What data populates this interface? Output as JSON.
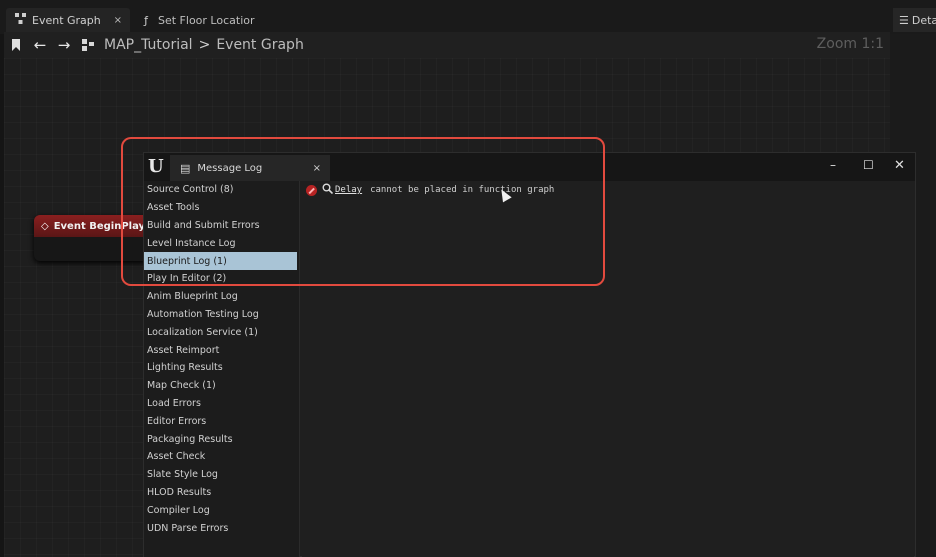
{
  "tabs": [
    {
      "label": "Event Graph",
      "icon": "graph-icon",
      "close": "×"
    },
    {
      "label": "Set Floor Locatior",
      "icon": "function-icon",
      "icon_glyph": "ƒ"
    }
  ],
  "details_tab": {
    "label": "Deta",
    "icon": "details-icon"
  },
  "toolbar": {
    "breadcrumb": [
      "MAP_Tutorial",
      "Event Graph"
    ],
    "separator": ">",
    "zoom": "Zoom 1:1"
  },
  "graph": {
    "event_node": {
      "label": "Event BeginPlay",
      "color": "#8a1f1f"
    }
  },
  "message_log": {
    "title": "Message Log",
    "close": "×",
    "categories": [
      "Source Control (8)",
      "Asset Tools",
      "Build and Submit Errors",
      "Level Instance Log",
      "Blueprint Log (1)",
      "Play In Editor (2)",
      "Anim Blueprint Log",
      "Automation Testing Log",
      "Localization Service (1)",
      "Asset Reimport",
      "Lighting Results",
      "Map Check (1)",
      "Load Errors",
      "Editor Errors",
      "Packaging Results",
      "Asset Check",
      "Slate Style Log",
      "HLOD Results",
      "Compiler Log",
      "UDN Parse Errors"
    ],
    "selected_category": "Blueprint Log (1)",
    "message": {
      "severity": "error",
      "link": "Delay",
      "text": "cannot be placed in function graph"
    }
  },
  "colors": {
    "highlight": "#e24a3e",
    "selection": "#a9c4d6",
    "error": "#b72323"
  }
}
